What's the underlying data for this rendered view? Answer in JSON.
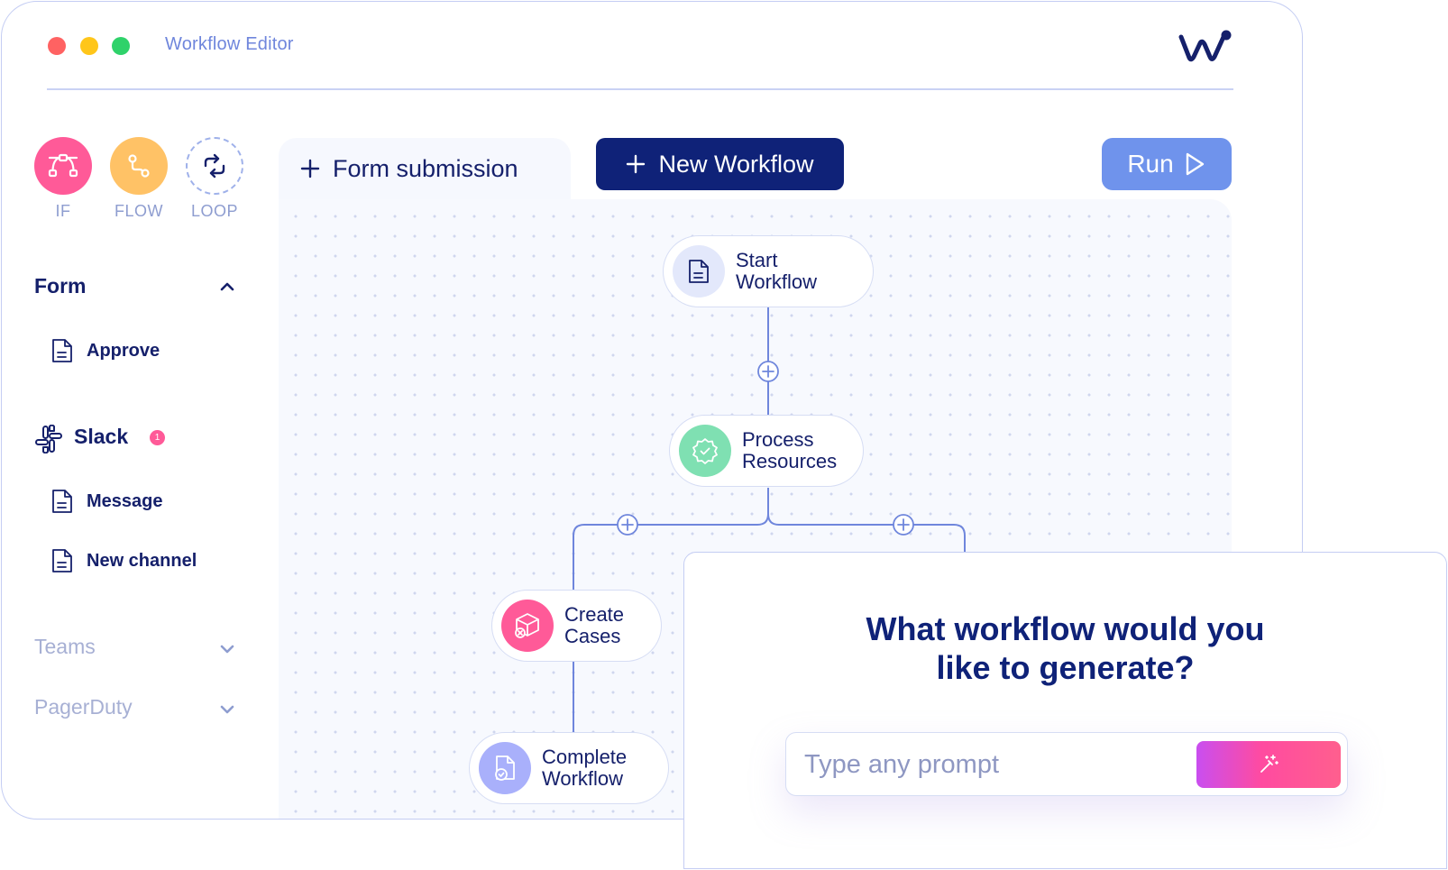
{
  "window": {
    "title": "Workflow Editor"
  },
  "palette": [
    {
      "label": "IF",
      "icon": "if-branch-icon",
      "color": "#ff5a98"
    },
    {
      "label": "FLOW",
      "icon": "flow-icon",
      "color": "#ffc266"
    },
    {
      "label": "LOOP",
      "icon": "loop-icon",
      "color": "#ffffff"
    }
  ],
  "sidebar": {
    "form": {
      "label": "Form",
      "expanded": true,
      "items": [
        {
          "label": "Approve",
          "icon": "document-icon"
        }
      ]
    },
    "slack": {
      "label": "Slack",
      "badge": "1",
      "items": [
        {
          "label": "Message",
          "icon": "document-icon"
        },
        {
          "label": "New channel",
          "icon": "document-icon"
        }
      ]
    },
    "teams": {
      "label": "Teams",
      "expanded": false
    },
    "pagerduty": {
      "label": "PagerDuty",
      "expanded": false
    }
  },
  "tabs": {
    "form_submission": "Form submission"
  },
  "toolbar": {
    "new_workflow": "New Workflow",
    "run": "Run"
  },
  "workflow": {
    "nodes": [
      {
        "id": "start",
        "label": "Start\nWorkflow",
        "icon": "document-icon",
        "color": "#e3e8fb"
      },
      {
        "id": "process",
        "label": "Process\nResources",
        "icon": "verified-badge-icon",
        "color": "#7fe0b2"
      },
      {
        "id": "create",
        "label": "Create\nCases",
        "icon": "cube-cancel-icon",
        "color": "#ff5a98"
      },
      {
        "id": "complete",
        "label": "Complete\nWorkflow",
        "icon": "file-check-icon",
        "color": "#a9b0fb"
      }
    ]
  },
  "prompt_panel": {
    "question_line1": "What workflow would you",
    "question_line2": "like to generate?",
    "input_placeholder": "Type any prompt",
    "generate_icon": "magic-wand-icon"
  },
  "colors": {
    "accent_dark": "#0f2278",
    "accent_run": "#6f93ec",
    "pink": "#ff5a98"
  }
}
